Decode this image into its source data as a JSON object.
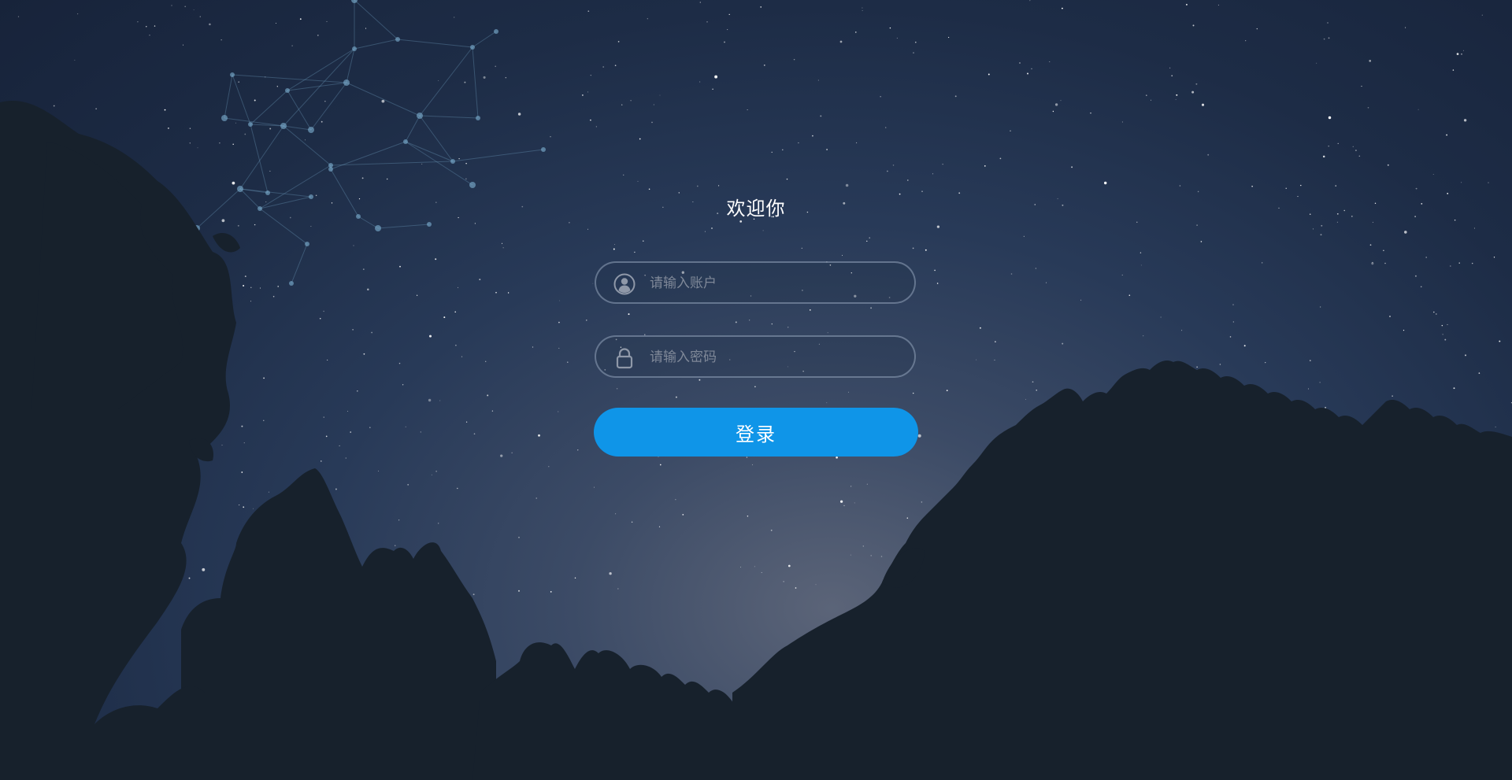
{
  "login": {
    "title": "欢迎你",
    "account_placeholder": "请输入账户",
    "password_placeholder": "请输入密码",
    "account_icon": "user-circle-icon",
    "password_icon": "lock-icon",
    "submit_label": "登录"
  },
  "colors": {
    "accent": "#0f95e8",
    "sky_top": "#17233a",
    "sky_horizon": "#5b6478",
    "tree_silhouette": "#17212c",
    "field_border": "#96a5be"
  }
}
